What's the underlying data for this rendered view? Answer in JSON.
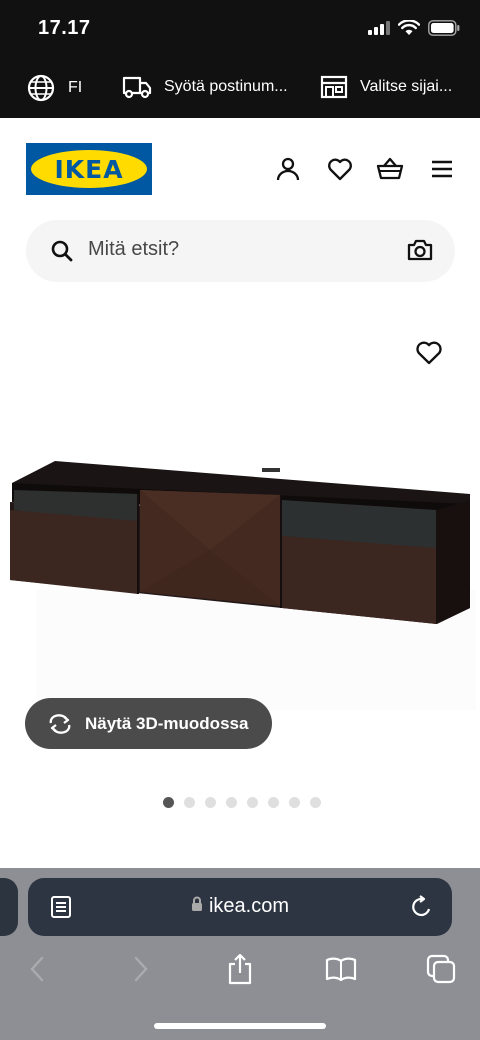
{
  "status_bar": {
    "time": "17.17"
  },
  "utility_bar": {
    "language": "FI",
    "postcode": "Syötä postinum...",
    "store": "Valitse sijai..."
  },
  "header": {
    "logo_text": "IKEA",
    "icons": [
      "user-icon",
      "heart-icon",
      "basket-icon",
      "menu-icon"
    ]
  },
  "search": {
    "placeholder": "Mitä etsit?"
  },
  "product": {
    "view_3d_label": "Näytä 3D-muodossa",
    "carousel": {
      "total": 8,
      "active_index": 0
    }
  },
  "browser": {
    "url": "ikea.com"
  },
  "colors": {
    "ikea_blue": "#0058a3",
    "ikea_yellow": "#ffdb00",
    "dark_bar": "#111111"
  }
}
